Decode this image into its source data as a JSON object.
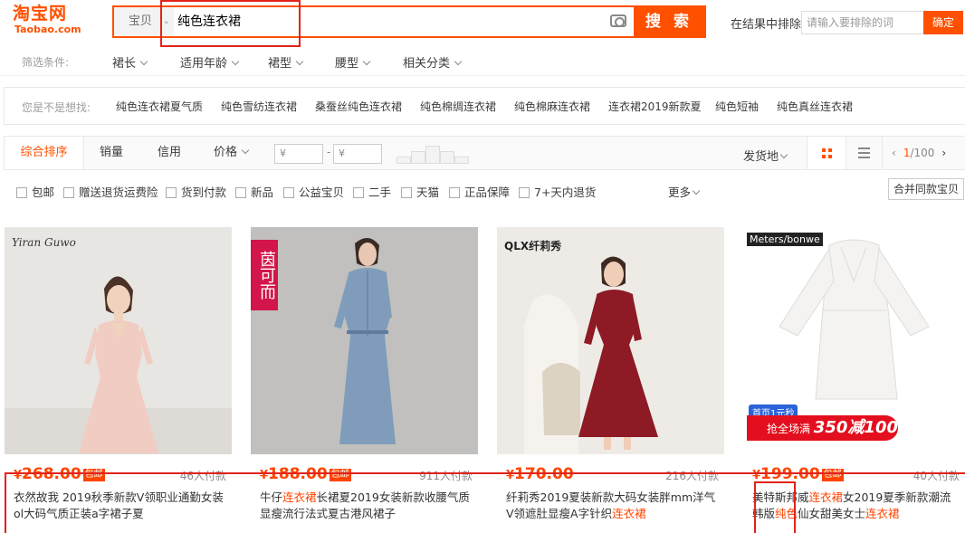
{
  "header": {
    "logo_cn": "淘宝网",
    "logo_en": "Taobao.com",
    "search_category": "宝贝",
    "search_query": "纯色连衣裙",
    "search_button": "搜 索",
    "exclude_label": "在结果中排除",
    "exclude_placeholder": "请输入要排除的词",
    "exclude_button": "确定"
  },
  "filters": {
    "label": "筛选条件:",
    "items": [
      "裙长",
      "适用年龄",
      "裙型",
      "腰型",
      "相关分类"
    ]
  },
  "suggest": {
    "label": "您是不是想找:",
    "items": [
      "纯色连衣裙夏气质",
      "纯色雪纺连衣裙",
      "桑蚕丝纯色连衣裙",
      "纯色棉绸连衣裙",
      "纯色棉麻连衣裙",
      "连衣裙2019新款夏",
      "纯色短袖",
      "纯色真丝连衣裙"
    ]
  },
  "sortbar": {
    "tabs": [
      "综合排序",
      "销量",
      "信用",
      "价格"
    ],
    "price_min_placeholder": "¥",
    "price_max_placeholder": "¥",
    "price_dash": "-",
    "shipfrom": "发货地",
    "pager_current": "1",
    "pager_total": "/100"
  },
  "services": {
    "items": [
      "包邮",
      "赠送退货运费险",
      "货到付款",
      "新品",
      "公益宝贝",
      "二手",
      "天猫",
      "正品保障",
      "7+天内退货"
    ],
    "more": "更多",
    "merge": "合并同款宝贝"
  },
  "products": [
    {
      "price_symbol": "¥",
      "price": "268.00",
      "badge": "包邮",
      "sales": "46人付款",
      "brand": "Yiran Guwo",
      "title_a": "衣然故我 2019秋季新款V领职业通勤女装ol大码气质正装a字裙子夏",
      "title_hl": "",
      "title_b": ""
    },
    {
      "price_symbol": "¥",
      "price": "188.00",
      "badge": "包邮",
      "sales": "911人付款",
      "brand": "茵可而",
      "title_a": "牛仔",
      "title_hl": "连衣裙",
      "title_b": "长裙夏2019女装新款收腰气质显瘦流行法式夏古港风裙子"
    },
    {
      "price_symbol": "¥",
      "price": "170.00",
      "badge": "",
      "sales": "216人付款",
      "brand": "QLX纤莉秀",
      "title_a": "纤莉秀2019夏装新款大码女装胖mm洋气V领遮肚显瘦A字针织",
      "title_hl": "连衣裙",
      "title_b": ""
    },
    {
      "price_symbol": "¥",
      "price": "199.00",
      "badge": "包邮",
      "sales": "40人付款",
      "brand": "Meters/bonwe",
      "promo_top": "首页1元秒",
      "promo_main": "抢全场满",
      "promo_num": "350减100",
      "title_a": "美特斯邦威",
      "title_hl": "连衣裙",
      "title_b": "女2019夏季新款潮流韩版",
      "title_hl2": "纯色",
      "title_c": "仙女甜美女士",
      "title_hl3": "连衣裙"
    }
  ],
  "colors": {
    "brand": "#ff5000",
    "price": "#ff4400",
    "annotation": "#e2231a"
  }
}
